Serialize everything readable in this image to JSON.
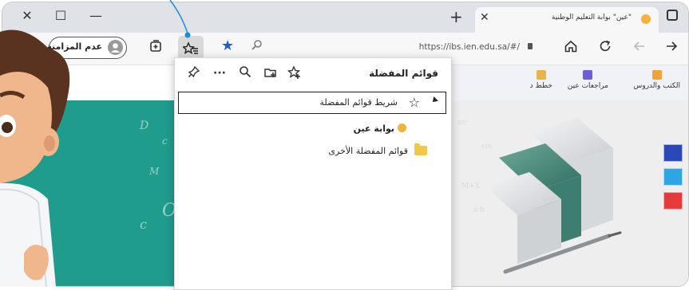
{
  "window": {
    "tab_title": "\"عين\" بوابة التعليم الوطنية",
    "new_tab_symbol": "+",
    "tab_close_symbol": "✕",
    "minimize_symbol": "—",
    "maximize_symbol": "☐",
    "close_symbol": "✕"
  },
  "toolbar": {
    "sync_label": "عدم المزامنة",
    "url": "https://ibs.ien.edu.sa/#/",
    "icons": [
      "back-icon",
      "refresh-icon",
      "home-icon",
      "lock-icon",
      "zoom-icon",
      "add-favorite-icon",
      "favorites-hub-icon",
      "collections-icon"
    ]
  },
  "favorites_panel": {
    "title": "قوائم المفضلة",
    "favorites_bar_label": "شريط قوائم المفضلة",
    "site_item": "بوابة عين",
    "other_folder": "قوائم المفضلة الأخرى",
    "icons": [
      "add-favorite-icon",
      "add-folder-icon",
      "search-icon",
      "more-icon",
      "pin-icon"
    ]
  },
  "site_nav": {
    "items": [
      "الكتب والدروس",
      "مراجعات عين",
      "خطط د"
    ]
  },
  "colors": {
    "teal": "#1f9c8c",
    "accent_blue": "#1a61c9",
    "side_buttons": [
      "#2b47b8",
      "#2da6e6",
      "#e53b3b"
    ]
  }
}
